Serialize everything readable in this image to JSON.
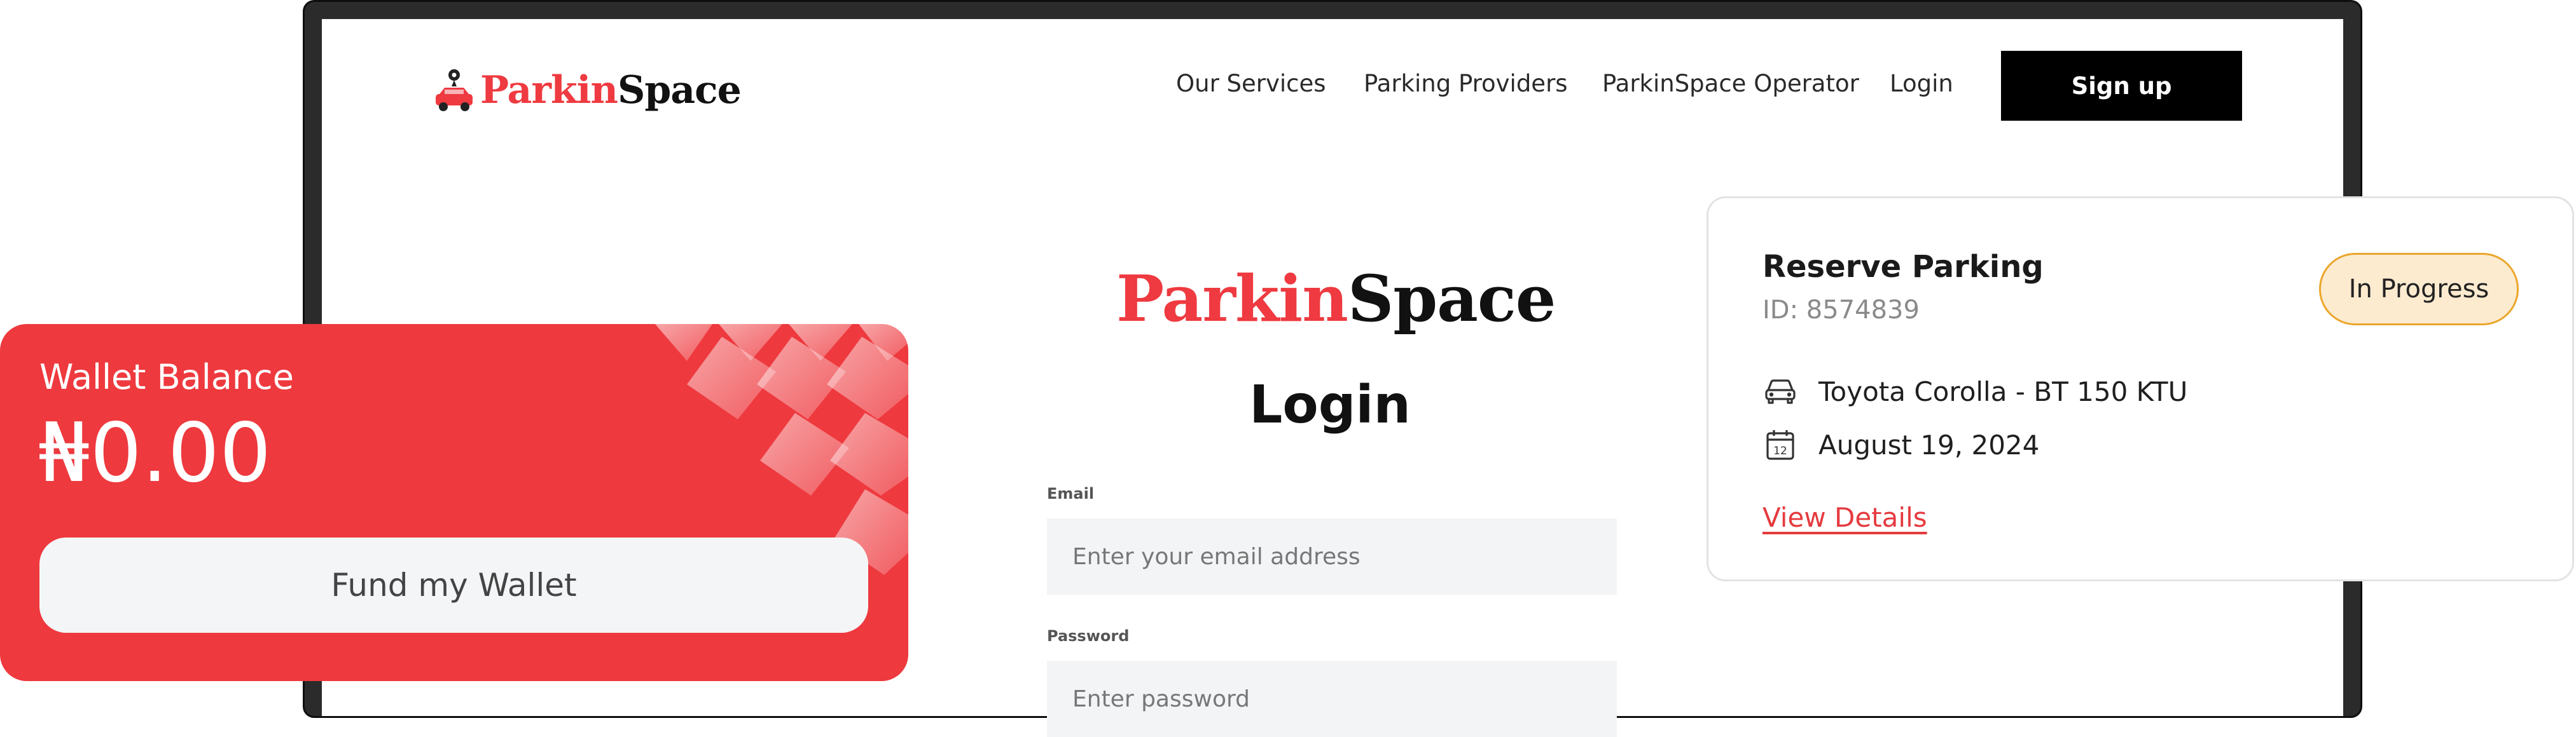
{
  "brand": {
    "logo_red": "Parkin",
    "logo_dark": "Space",
    "red_color": "#ee3a40",
    "dark_color": "#111111"
  },
  "nav": {
    "links": [
      "Our Services",
      "Parking Providers",
      "ParkinSpace Operator",
      "Login"
    ],
    "signup_label": "Sign up"
  },
  "login_form": {
    "title": "Login",
    "email_label": "Email",
    "email_placeholder": "Enter your email address",
    "password_label": "Password",
    "password_placeholder": "Enter password"
  },
  "wallet": {
    "label": "Wallet Balance",
    "amount": "₦0.00",
    "fund_button": "Fund my Wallet",
    "color": "#ee393e"
  },
  "reservation": {
    "title": "Reserve Parking",
    "id_text": "ID: 8574839",
    "status": "In Progress",
    "vehicle": "Toyota Corolla - BT 150 KTU",
    "date": "August 19, 2024",
    "calendar_day": "12",
    "link": "View Details",
    "car_icon": "car-icon",
    "calendar_icon": "calendar-icon"
  }
}
